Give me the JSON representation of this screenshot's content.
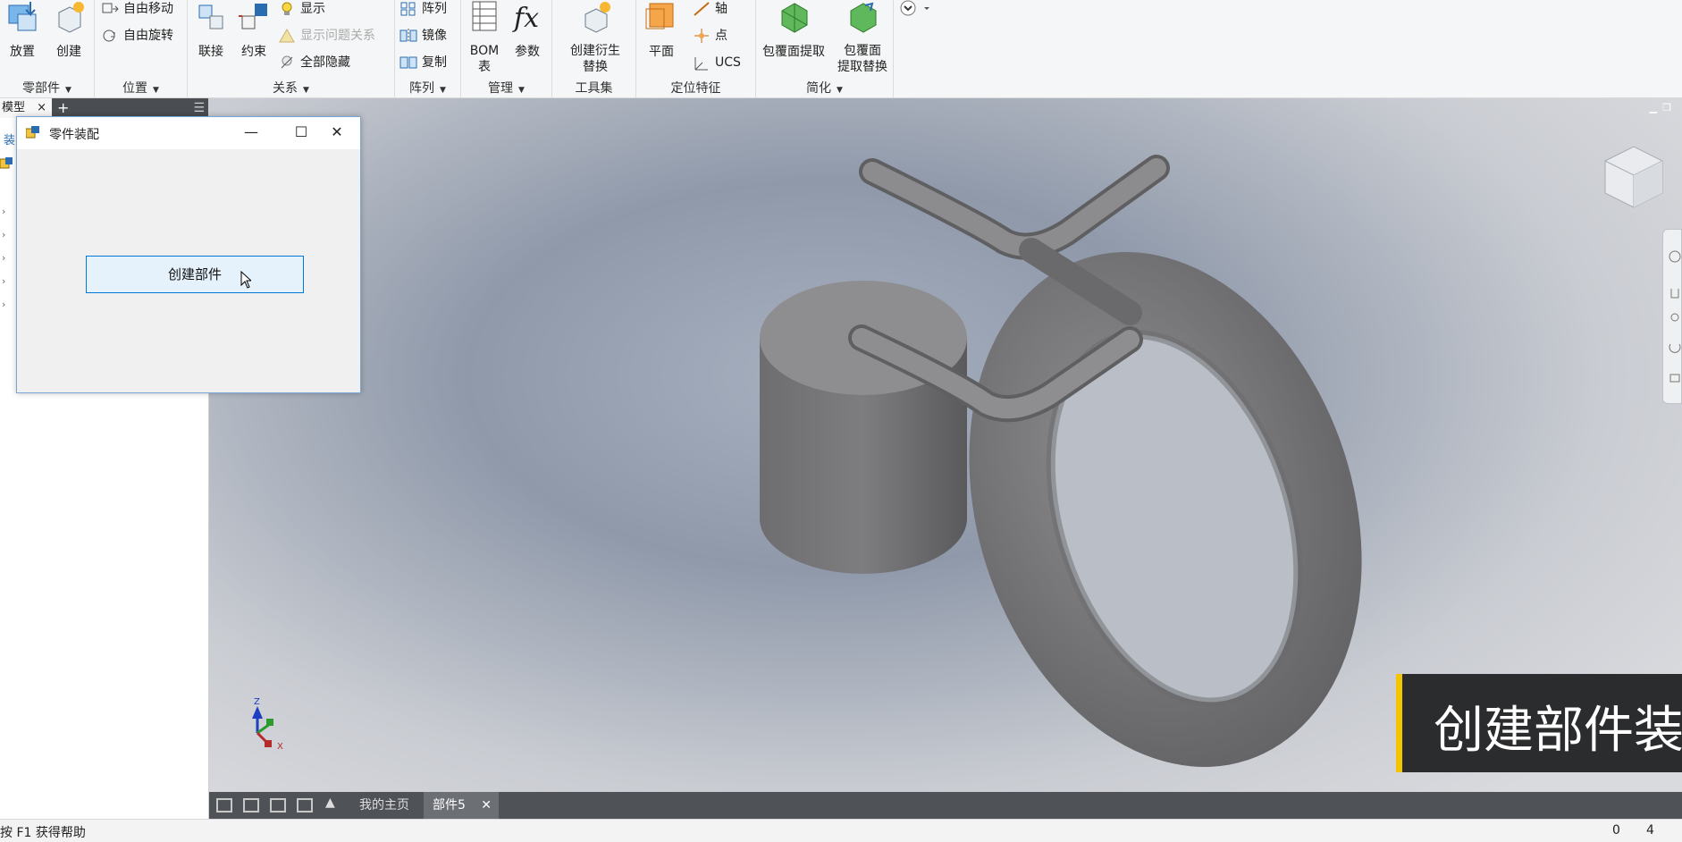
{
  "ribbon": {
    "place_label": "放置",
    "create_label": "创建",
    "components_panel": "零部件",
    "free_move": "自由移动",
    "free_rotate": "自由旋转",
    "position_panel": "位置",
    "joint_label": "联接",
    "constrain_label": "约束",
    "show_label": "显示",
    "show_problem_label": "显示问题关系",
    "hide_all_label": "全部隐藏",
    "relationships_panel": "关系",
    "pattern_label": "阵列",
    "mirror_label": "镜像",
    "copy_label": "复制",
    "pattern_panel": "阵列",
    "bom_label": "BOM\n表",
    "bom_line1": "BOM",
    "bom_line2": "表",
    "params_label": "参数",
    "manage_panel": "管理",
    "derive_line1": "创建衍生",
    "derive_line2": "替换",
    "tools_panel": "工具集",
    "plane_label": "平面",
    "axis_label": "轴",
    "point_label": "点",
    "ucs_label": "UCS",
    "workfeatures_panel": "定位特征",
    "shrinkwrap_label": "包覆面提取",
    "shrinkwrap_sub_line1": "包覆面",
    "shrinkwrap_sub_line2": "提取替换",
    "simplify_panel": "简化"
  },
  "browser": {
    "tab_model": "模型",
    "tab_close": "×",
    "add": "+",
    "menu": "☰",
    "root_prefix": "装"
  },
  "dialog": {
    "title": "零件装配",
    "minimize": "—",
    "maximize": "☐",
    "close": "✕",
    "button_label": "创建部件"
  },
  "caption": {
    "text": "创建部件装配零"
  },
  "docbar": {
    "home_tab": "我的主页",
    "doc_tab": "部件5",
    "doc_close": "✕"
  },
  "status": {
    "help": "按 F1 获得帮助",
    "n1": "0",
    "n2": "4"
  },
  "colors": {
    "accent": "#0078d7",
    "caption_bar": "#f2c500",
    "model_gray": "#8a8a8a"
  }
}
